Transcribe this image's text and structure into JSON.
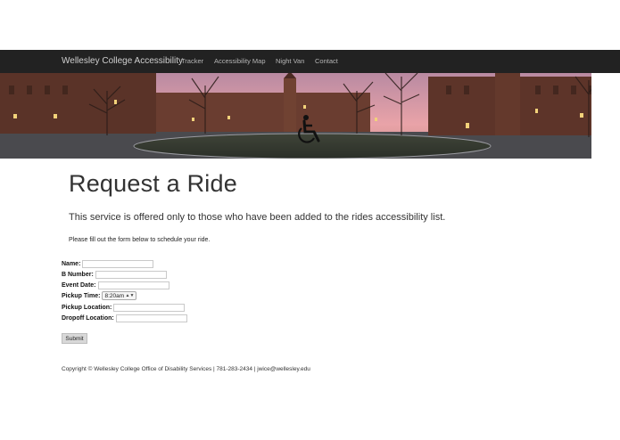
{
  "nav": {
    "brand": "Wellesley College Accessibility",
    "links": [
      "Tracker",
      "Accessibility Map",
      "Night Van",
      "Contact"
    ]
  },
  "banner": {
    "icon": "wheelchair-icon",
    "sky_color": "#e9a3a8",
    "building_color": "#5a3328"
  },
  "main": {
    "title": "Request a Ride",
    "lead": "This service is offered only to those who have been added to the rides accessibility list.",
    "note": "Please fill out the form below to schedule your ride."
  },
  "form": {
    "name_label": "Name:",
    "bnumber_label": "B Number:",
    "date_label": "Event Date:",
    "time_label": "Pickup Time:",
    "time_value": "8:20am",
    "pickup_label": "Pickup Location:",
    "dropoff_label": "Dropoff Location:",
    "submit_label": "Submit"
  },
  "footer": {
    "text": "Copyright © Wellesley College Office of Disability Services | 781-283-2434 | jwice@wellesley.edu"
  }
}
